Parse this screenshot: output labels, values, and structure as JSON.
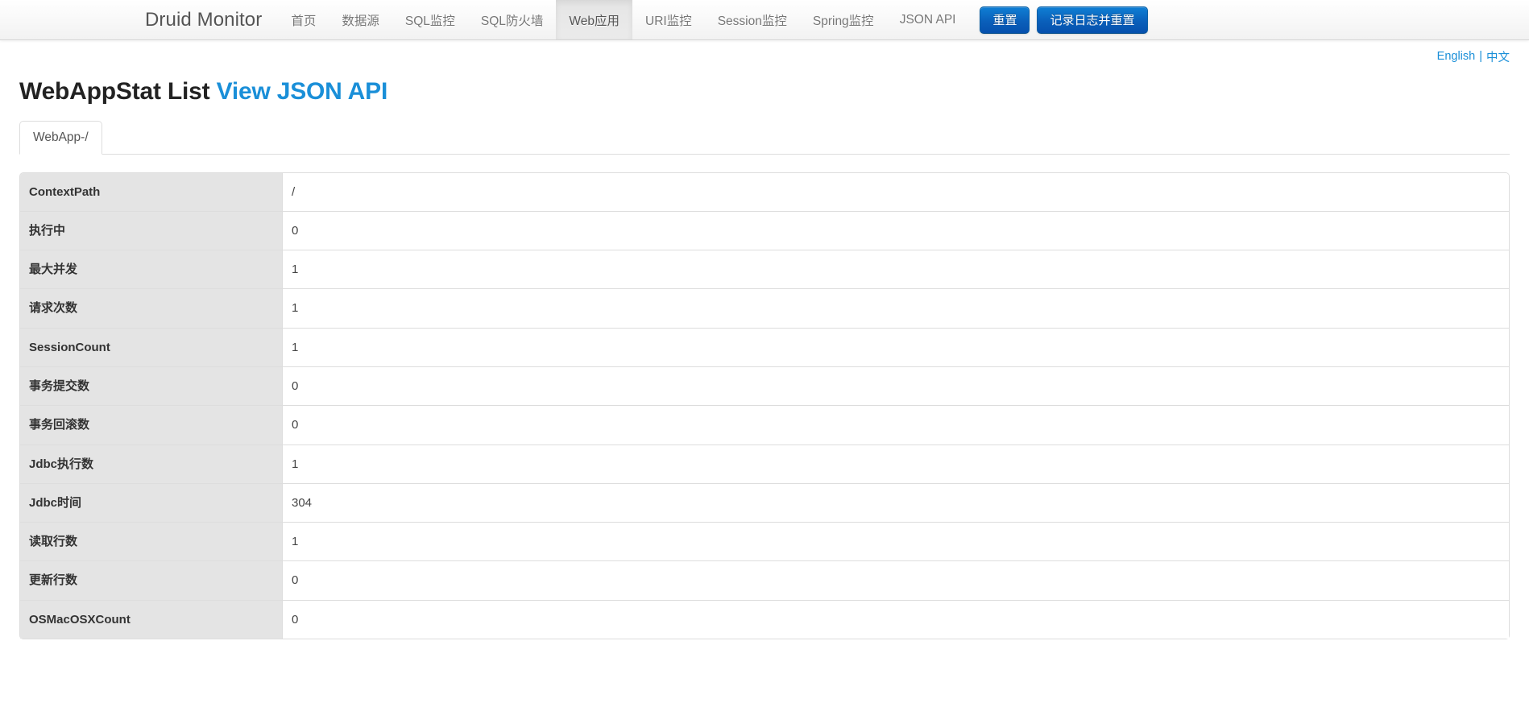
{
  "navbar": {
    "brand": "Druid Monitor",
    "items": [
      {
        "label": "首页",
        "active": false
      },
      {
        "label": "数据源",
        "active": false
      },
      {
        "label": "SQL监控",
        "active": false
      },
      {
        "label": "SQL防火墙",
        "active": false
      },
      {
        "label": "Web应用",
        "active": true
      },
      {
        "label": "URI监控",
        "active": false
      },
      {
        "label": "Session监控",
        "active": false
      },
      {
        "label": "Spring监控",
        "active": false
      },
      {
        "label": "JSON API",
        "active": false
      }
    ],
    "buttons": [
      {
        "label": "重置",
        "name": "reset-button"
      },
      {
        "label": "记录日志并重置",
        "name": "log-and-reset-button"
      }
    ],
    "accent_color": "#0a5fba"
  },
  "lang_bar": {
    "english_label": "English",
    "separator": "|",
    "chinese_label": "中文",
    "link_color": "#1a8fd8"
  },
  "page": {
    "title": "WebAppStat List",
    "json_api_link": "View JSON API"
  },
  "tabs": [
    {
      "label": "WebApp-/",
      "active": true
    }
  ],
  "table": {
    "rows": [
      {
        "key": "ContextPath",
        "value": "/"
      },
      {
        "key": "执行中",
        "value": "0"
      },
      {
        "key": "最大并发",
        "value": "1"
      },
      {
        "key": "请求次数",
        "value": "1"
      },
      {
        "key": "SessionCount",
        "value": "1"
      },
      {
        "key": "事务提交数",
        "value": "0"
      },
      {
        "key": "事务回滚数",
        "value": "0"
      },
      {
        "key": "Jdbc执行数",
        "value": "1"
      },
      {
        "key": "Jdbc时间",
        "value": "304"
      },
      {
        "key": "读取行数",
        "value": "1"
      },
      {
        "key": "更新行数",
        "value": "0"
      },
      {
        "key": "OSMacOSXCount",
        "value": "0"
      }
    ]
  }
}
